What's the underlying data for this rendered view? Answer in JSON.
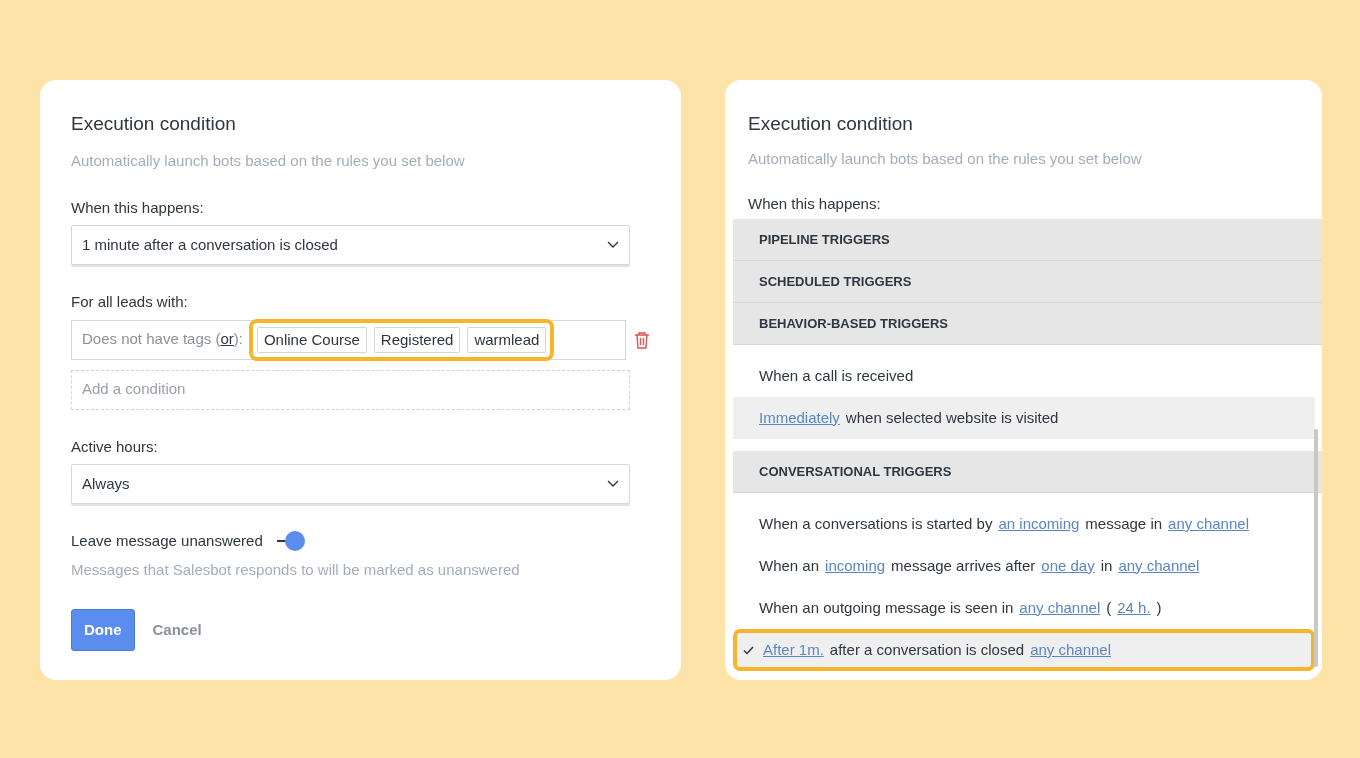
{
  "left_panel": {
    "title": "Execution condition",
    "subtitle": "Automatically launch bots based on the rules you set below",
    "when_label": "When this happens:",
    "when_value": "1 minute after a conversation is closed",
    "leads_label": "For all leads with:",
    "condition": {
      "segments": [
        {
          "text": "Does not have tags (",
          "link": false
        },
        {
          "text": "or",
          "link": true
        },
        {
          "text": "):",
          "link": false
        }
      ],
      "tags": [
        "Online Course",
        "Registered",
        "warmlead"
      ],
      "highlighted": true
    },
    "add_condition_placeholder": "Add a condition",
    "hours_label": "Active hours:",
    "hours_value": "Always",
    "toggle": {
      "label": "Leave message unanswered",
      "on": true
    },
    "hint": "Messages that Salesbot responds to will be marked as unanswered",
    "buttons": [
      {
        "label": "Done",
        "kind": "primary"
      },
      {
        "label": "Cancel",
        "kind": "secondary"
      }
    ]
  },
  "right_panel": {
    "title": "Execution condition",
    "subtitle": "Automatically launch bots based on the rules you set below",
    "when_label": "When this happens:",
    "menu": [
      {
        "kind": "header",
        "text": "PIPELINE TRIGGERS"
      },
      {
        "kind": "header",
        "text": "SCHEDULED TRIGGERS"
      },
      {
        "kind": "header",
        "text": "BEHAVIOR-BASED TRIGGERS"
      },
      {
        "kind": "option",
        "selected": false,
        "hovered": false,
        "highlighted": false,
        "segments": [
          {
            "text": "When a call is received",
            "link": false
          }
        ]
      },
      {
        "kind": "option",
        "selected": false,
        "hovered": true,
        "highlighted": false,
        "segments": [
          {
            "text": "Immediately",
            "link": true
          },
          {
            "text": "when selected website is visited",
            "link": false
          }
        ]
      },
      {
        "kind": "header",
        "text": "CONVERSATIONAL TRIGGERS"
      },
      {
        "kind": "option",
        "selected": false,
        "hovered": false,
        "highlighted": false,
        "segments": [
          {
            "text": "When a conversations is started by",
            "link": false
          },
          {
            "text": "an incoming",
            "link": true
          },
          {
            "text": "message in",
            "link": false
          },
          {
            "text": "any channel",
            "link": true
          }
        ]
      },
      {
        "kind": "option",
        "selected": false,
        "hovered": false,
        "highlighted": false,
        "segments": [
          {
            "text": "When an",
            "link": false
          },
          {
            "text": "incoming",
            "link": true
          },
          {
            "text": "message arrives after",
            "link": false
          },
          {
            "text": "one day",
            "link": true
          },
          {
            "text": "in",
            "link": false
          },
          {
            "text": "any channel",
            "link": true
          }
        ]
      },
      {
        "kind": "option",
        "selected": false,
        "hovered": false,
        "highlighted": false,
        "segments": [
          {
            "text": "When an outgoing message is seen in",
            "link": false
          },
          {
            "text": "any channel",
            "link": true
          },
          {
            "text": "(",
            "link": false
          },
          {
            "text": "24 h.",
            "link": true
          },
          {
            "text": ")",
            "link": false
          }
        ]
      },
      {
        "kind": "option",
        "selected": true,
        "hovered": true,
        "highlighted": true,
        "segments": [
          {
            "text": "After 1m.",
            "link": true
          },
          {
            "text": "after a conversation is closed",
            "link": false
          },
          {
            "text": "any channel",
            "link": true
          }
        ]
      }
    ]
  }
}
